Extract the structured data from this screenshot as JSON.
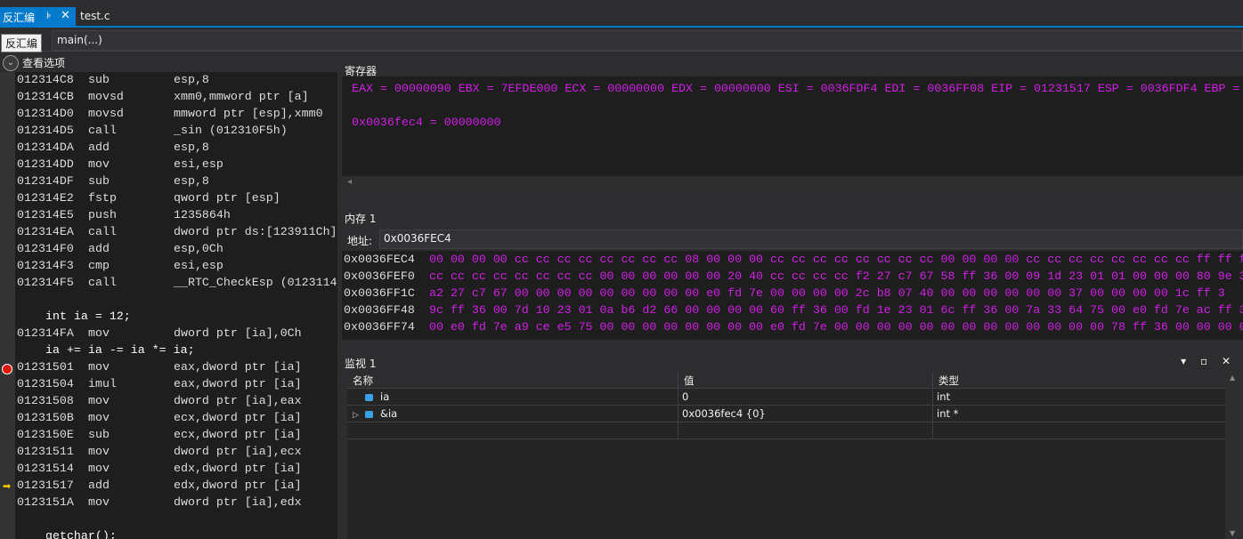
{
  "tabs": {
    "active": {
      "label": "反汇编",
      "pin": "⊧",
      "close": "✕"
    },
    "inactive": {
      "label": "test.c"
    }
  },
  "nav": {
    "tooltip": "反汇编",
    "function": "main(...)"
  },
  "view_options": {
    "label": "查看选项",
    "icon": "chevron-down-icon"
  },
  "disassembly": {
    "lines": [
      {
        "addr": "012314C8",
        "op": "sub",
        "args": "esp,8"
      },
      {
        "addr": "012314CB",
        "op": "movsd",
        "args": "xmm0,mmword ptr [a]"
      },
      {
        "addr": "012314D0",
        "op": "movsd",
        "args": "mmword ptr [esp],xmm0"
      },
      {
        "addr": "012314D5",
        "op": "call",
        "args": "_sin (012310F5h)"
      },
      {
        "addr": "012314DA",
        "op": "add",
        "args": "esp,8"
      },
      {
        "addr": "012314DD",
        "op": "mov",
        "args": "esi,esp"
      },
      {
        "addr": "012314DF",
        "op": "sub",
        "args": "esp,8"
      },
      {
        "addr": "012314E2",
        "op": "fstp",
        "args": "qword ptr [esp]"
      },
      {
        "addr": "012314E5",
        "op": "push",
        "args": "1235864h"
      },
      {
        "addr": "012314EA",
        "op": "call",
        "args": "dword ptr ds:[123911Ch]"
      },
      {
        "addr": "012314F0",
        "op": "add",
        "args": "esp,0Ch"
      },
      {
        "addr": "012314F3",
        "op": "cmp",
        "args": "esi,esp"
      },
      {
        "addr": "012314F5",
        "op": "call",
        "args": "__RTC_CheckEsp (0123114"
      },
      {
        "source": ""
      },
      {
        "source": "int ia = 12;"
      },
      {
        "addr": "012314FA",
        "op": "mov",
        "args": "dword ptr [ia],0Ch"
      },
      {
        "source": "ia += ia -= ia *= ia;"
      },
      {
        "addr": "01231501",
        "op": "mov",
        "args": "eax,dword ptr [ia]",
        "breakpoint": true
      },
      {
        "addr": "01231504",
        "op": "imul",
        "args": "eax,dword ptr [ia]"
      },
      {
        "addr": "01231508",
        "op": "mov",
        "args": "dword ptr [ia],eax"
      },
      {
        "addr": "0123150B",
        "op": "mov",
        "args": "ecx,dword ptr [ia]"
      },
      {
        "addr": "0123150E",
        "op": "sub",
        "args": "ecx,dword ptr [ia]"
      },
      {
        "addr": "01231511",
        "op": "mov",
        "args": "dword ptr [ia],ecx"
      },
      {
        "addr": "01231514",
        "op": "mov",
        "args": "edx,dword ptr [ia]"
      },
      {
        "addr": "01231517",
        "op": "add",
        "args": "edx,dword ptr [ia]",
        "current": true
      },
      {
        "addr": "0123151A",
        "op": "mov",
        "args": "dword ptr [ia],edx"
      },
      {
        "source": ""
      },
      {
        "source": "getchar();"
      }
    ]
  },
  "registers": {
    "title": "寄存器",
    "line1": "EAX = 00000090 EBX = 7EFDE000 ECX = 00000000 EDX = 00000000 ESI = 0036FDF4 EDI = 0036FF08 EIP = 01231517 ESP = 0036FDF4 EBP =",
    "line2": "0x0036fec4 = 00000000",
    "scroll_left": "◂"
  },
  "memory": {
    "title": "内存 1",
    "address_label": "地址:",
    "address_value": "0x0036FEC4",
    "rows": [
      {
        "addr": "0x0036FEC4",
        "bytes": "00 00 00 00 cc cc cc cc cc cc cc cc 08 00 00 00 cc cc cc cc cc cc cc cc 00 00 00 00 cc cc cc cc cc cc cc cc ff ff ff"
      },
      {
        "addr": "0x0036FEF0",
        "bytes": "cc cc cc cc cc cc cc cc 00 00 00 00 00 00 20 40 cc cc cc cc f2 27 c7 67 58 ff 36 00 09 1d 23 01 01 00 00 00 80 9e 3"
      },
      {
        "addr": "0x0036FF1C",
        "bytes": "a2 27 c7 67 00 00 00 00 00 00 00 00 00 e0 fd 7e 00 00 00 00 2c b8 07 40 00 00 00 00 00 00 37 00 00 00 00 1c ff 3"
      },
      {
        "addr": "0x0036FF48",
        "bytes": "9c ff 36 00 7d 10 23 01 0a b6 d2 66 00 00 00 00 60 ff 36 00 fd 1e 23 01 6c ff 36 00 7a 33 64 75 00 e0 fd 7e ac ff 3"
      },
      {
        "addr": "0x0036FF74",
        "bytes": "00 e0 fd 7e a9 ce e5 75 00 00 00 00 00 00 00 00 e0 fd 7e 00 00 00 00 00 00 00 00 00 00 00 00 00 78 ff 36 00 00 00 0"
      }
    ]
  },
  "watch": {
    "title": "监视 1",
    "title_icons": "▾ ▫ ✕",
    "columns": {
      "name": "名称",
      "value": "值",
      "type": "类型"
    },
    "rows": [
      {
        "name": "ia",
        "value": "0",
        "type": "int",
        "expander": ""
      },
      {
        "name": "&ia",
        "value": "0x0036fec4 {0}",
        "type": "int *",
        "expander": "▷"
      }
    ]
  },
  "colors": {
    "accent": "#007acc",
    "register_text": "#d21ee6",
    "breakpoint": "#e51400",
    "current_arrow": "#ffcc00"
  }
}
